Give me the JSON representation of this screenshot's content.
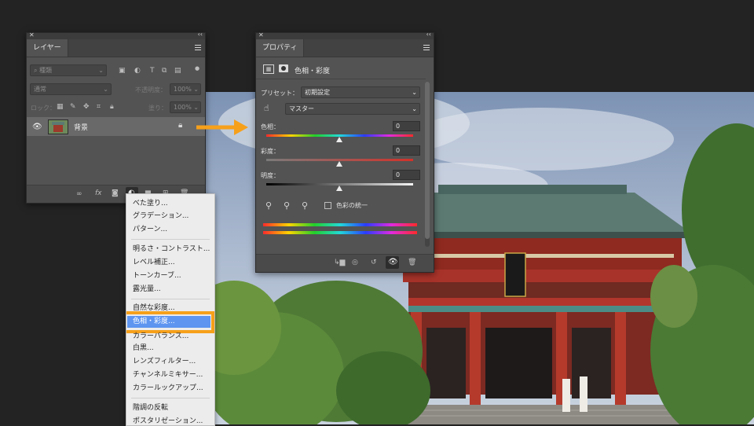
{
  "layers_panel": {
    "tab": "レイヤー",
    "filter_placeholder": "種類",
    "blend_mode": "通常",
    "opacity_label": "不透明度：",
    "opacity_value": "100%",
    "lock_label": "ロック：",
    "fill_label": "塗り：",
    "fill_value": "100%",
    "layers": [
      {
        "name": "背景"
      }
    ]
  },
  "properties_panel": {
    "tab": "プロパティ",
    "adjustment_title": "色相・彩度",
    "preset_label": "プリセット：",
    "preset_value": "初期設定",
    "channel_value": "マスター",
    "hue_label": "色相：",
    "hue_value": "0",
    "saturation_label": "彩度：",
    "saturation_value": "0",
    "lightness_label": "明度：",
    "lightness_value": "0",
    "colorize_label": "色彩の統一"
  },
  "adjustment_menu": {
    "items": [
      "べた塗り...",
      "グラデーション...",
      "パターン...",
      "明るさ・コントラスト...",
      "レベル補正...",
      "トーンカーブ...",
      "露光量...",
      "自然な彩度...",
      "色相・彩度...",
      "カラーバランス...",
      "白黒...",
      "レンズフィルター...",
      "チャンネルミキサー...",
      "カラールックアップ...",
      "階調の反転",
      "ポスタリゼーション..."
    ],
    "highlighted": "色相・彩度..."
  },
  "colors": {
    "accent_orange": "#f6a01a",
    "highlight_blue": "#5d95f0"
  }
}
